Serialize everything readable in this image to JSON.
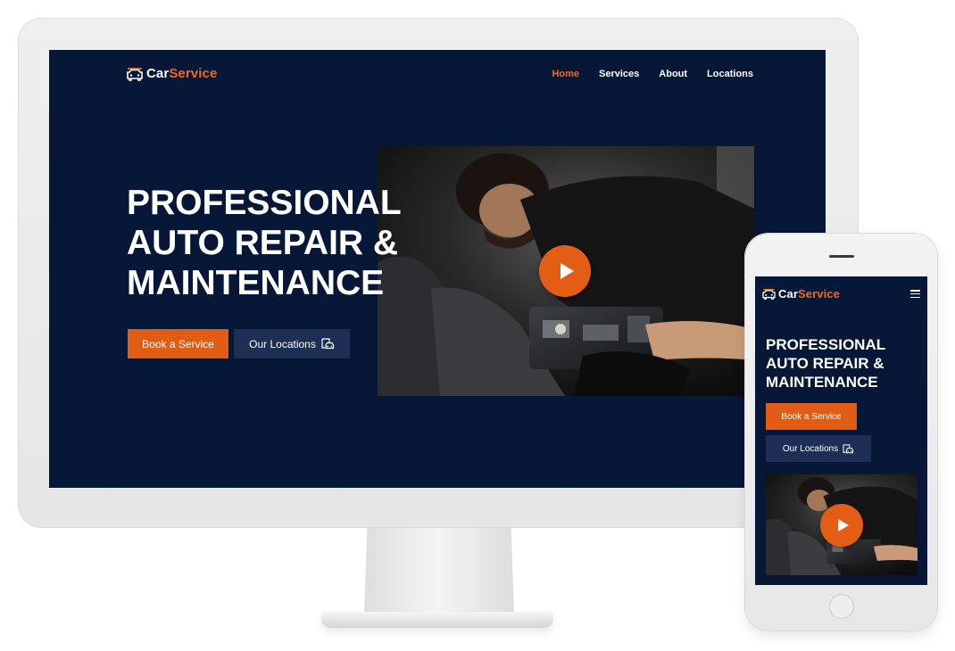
{
  "brand": {
    "name_part1": "Car",
    "name_part2": "Service",
    "accent_color": "#ee6a1f",
    "background_color": "#061737"
  },
  "nav": {
    "items": [
      {
        "label": "Home",
        "active": true
      },
      {
        "label": "Services",
        "active": false
      },
      {
        "label": "About",
        "active": false
      },
      {
        "label": "Locations",
        "active": false
      }
    ]
  },
  "hero": {
    "headline_lines": [
      "PROFESSIONAL",
      "AUTO REPAIR &",
      "MAINTENANCE"
    ],
    "primary_button": "Book a Service",
    "secondary_button": "Our Locations",
    "secondary_button_icon": "car-location-icon",
    "video_play_icon": "play-icon"
  },
  "mobile": {
    "menu_icon": "hamburger-menu-icon"
  }
}
